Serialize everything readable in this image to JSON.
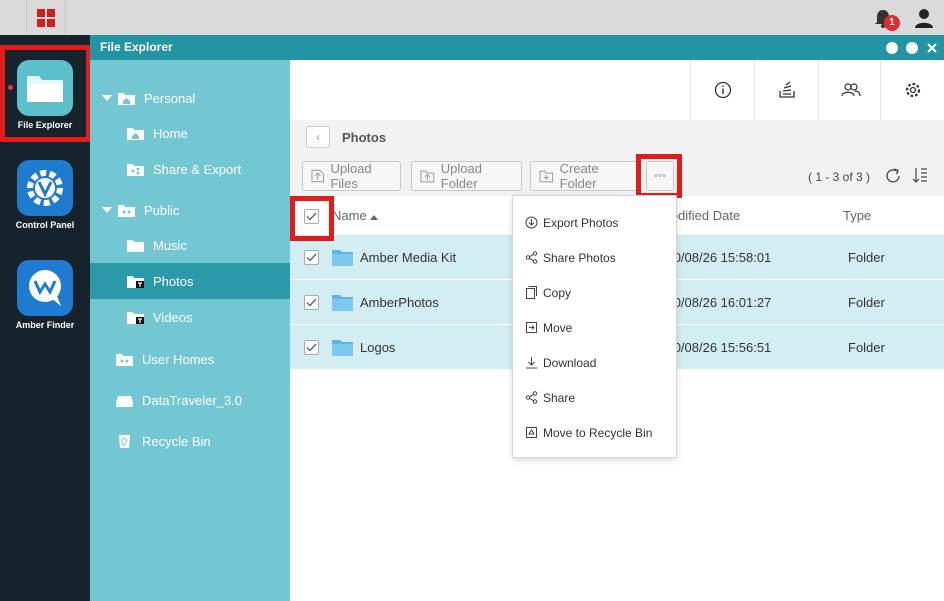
{
  "topbar": {
    "notification_count": "1"
  },
  "dock": {
    "apps": [
      {
        "label": "File Explorer"
      },
      {
        "label": "Control Panel"
      },
      {
        "label": "Amber Finder"
      }
    ]
  },
  "window": {
    "title": "File Explorer"
  },
  "sidebar": {
    "personal": "Personal",
    "home": "Home",
    "share_export": "Share & Export",
    "public": "Public",
    "music": "Music",
    "photos": "Photos",
    "videos": "Videos",
    "user_homes": "User Homes",
    "datatraveler": "DataTraveler_3.0",
    "recycle_bin": "Recycle Bin"
  },
  "breadcrumb": {
    "current": "Photos"
  },
  "actions": {
    "upload_files": "Upload Files",
    "upload_folder": "Upload Folder",
    "create_folder": "Create Folder",
    "more": "◦◦◦",
    "count": "( 1 - 3 of 3 )"
  },
  "table": {
    "headers": {
      "name": "Name",
      "modified": "Modified Date",
      "type": "Type"
    },
    "rows": [
      {
        "name": "Amber Media Kit",
        "modified": "2020/08/26 15:58:01",
        "type": "Folder"
      },
      {
        "name": "AmberPhotos",
        "modified": "2020/08/26 16:01:27",
        "type": "Folder"
      },
      {
        "name": "Logos",
        "modified": "2020/08/26 15:56:51",
        "type": "Folder"
      }
    ]
  },
  "menu": {
    "items": [
      {
        "label": "Export Photos",
        "icon": "export-icon"
      },
      {
        "label": "Share Photos",
        "icon": "share-icon"
      },
      {
        "label": "Copy",
        "icon": "copy-icon"
      },
      {
        "label": "Move",
        "icon": "move-icon"
      },
      {
        "label": "Download",
        "icon": "download-icon"
      },
      {
        "label": "Share",
        "icon": "share-icon"
      },
      {
        "label": "Move to Recycle Bin",
        "icon": "recycle-bin-icon"
      }
    ]
  },
  "colors": {
    "accent": "#2394a4",
    "sidebar": "#73c7d3",
    "highlight": "#e21b1b",
    "row": "#d3eef2"
  }
}
